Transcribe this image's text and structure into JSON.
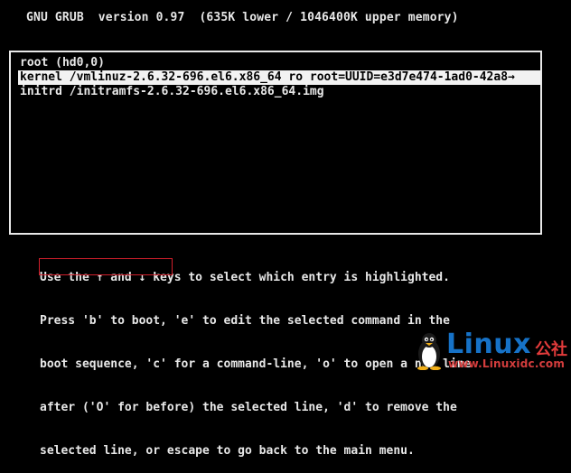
{
  "header": {
    "title": "GNU GRUB  version 0.97  (635K lower / 1046400K upper memory)"
  },
  "entries": [
    {
      "text": "root (hd0,0)",
      "selected": false
    },
    {
      "text": "kernel /vmlinuz-2.6.32-696.el6.x86_64 ro root=UUID=e3d7e474-1ad0-42a8→",
      "selected": true
    },
    {
      "text": "initrd /initramfs-2.6.32-696.el6.x86_64.img",
      "selected": false
    }
  ],
  "help": {
    "lines": [
      "Use the ↑ and ↓ keys to select which entry is highlighted.",
      "Press 'b' to boot, 'e' to edit the selected command in the",
      "boot sequence, 'c' for a command-line, 'o' to open a new line",
      "after ('O' for before) the selected line, 'd' to remove the",
      "selected line, or escape to go back to the main menu."
    ]
  },
  "watermark": {
    "brand": "Linux",
    "brand_cn": "公社",
    "url": "www.Linuxidc.com",
    "icon": "tux-penguin-icon"
  },
  "colors": {
    "background": "#000000",
    "text": "#e8e8e8",
    "selection_bg": "#f2f2f2",
    "annotation_box": "#d21f2b",
    "brand": "#1672c7"
  }
}
